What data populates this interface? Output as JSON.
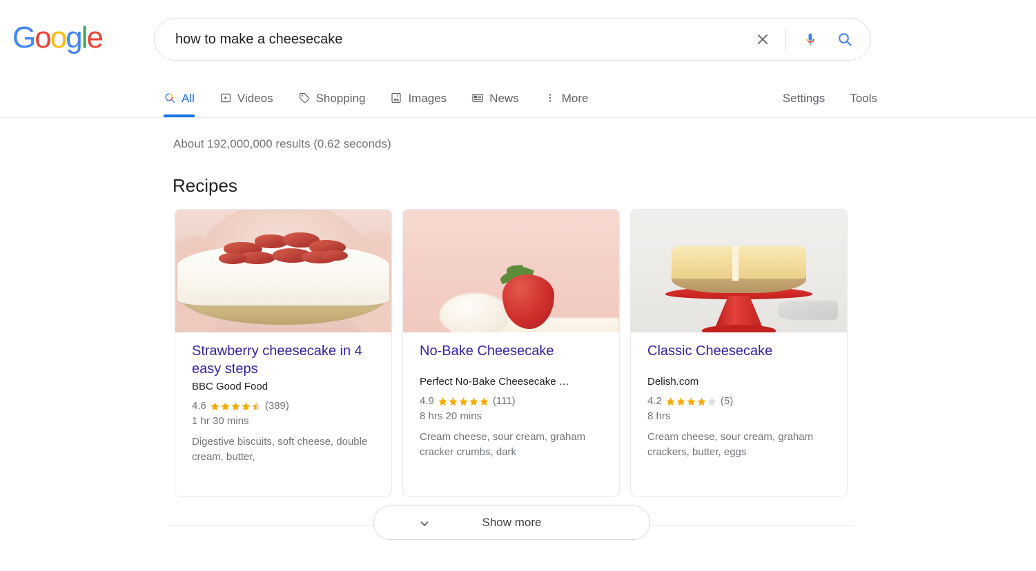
{
  "brand": {
    "name": "Google",
    "letters": [
      {
        "char": "G",
        "color": "#4285f4"
      },
      {
        "char": "o",
        "color": "#ea4335"
      },
      {
        "char": "o",
        "color": "#fbbc05"
      },
      {
        "char": "g",
        "color": "#4285f4"
      },
      {
        "char": "l",
        "color": "#34a853"
      },
      {
        "char": "e",
        "color": "#ea4335"
      }
    ]
  },
  "search": {
    "value": "how to make a cheesecake",
    "placeholder": "Search",
    "clear_icon": "close-icon",
    "mic_icon": "microphone-icon",
    "search_icon": "search-icon"
  },
  "nav": {
    "tabs": [
      {
        "label": "All",
        "icon": "search-icon",
        "active": true
      },
      {
        "label": "Videos",
        "icon": "video-icon",
        "active": false
      },
      {
        "label": "Shopping",
        "icon": "tag-icon",
        "active": false
      },
      {
        "label": "Images",
        "icon": "image-icon",
        "active": false
      },
      {
        "label": "News",
        "icon": "news-icon",
        "active": false
      },
      {
        "label": "More",
        "icon": "more-vertical-icon",
        "active": false
      }
    ],
    "settings_label": "Settings",
    "tools_label": "Tools",
    "active_color": "#1a73e8"
  },
  "results": {
    "stats": "About 192,000,000 results (0.62 seconds)",
    "section_title": "Recipes"
  },
  "recipes": [
    {
      "title": "Strawberry cheesecake in 4 easy steps",
      "source": "BBC Good Food",
      "rating": "4.6",
      "rating_value": 4.6,
      "reviews": "(389)",
      "time": "1 hr 30 mins",
      "ingredients": "Digestive biscuits, soft cheese, double cream, butter,",
      "image_alt": "strawberry-cheesecake-photo"
    },
    {
      "title": "No-Bake Cheesecake",
      "source": "Perfect No-Bake Cheesecake …",
      "rating": "4.9",
      "rating_value": 4.9,
      "reviews": "(111)",
      "time": "8 hrs 20 mins",
      "ingredients": "Cream cheese, sour cream, graham cracker crumbs, dark",
      "image_alt": "no-bake-cheesecake-photo"
    },
    {
      "title": "Classic Cheesecake",
      "source": "Delish.com",
      "rating": "4.2",
      "rating_value": 4.2,
      "reviews": "(5)",
      "time": "8 hrs",
      "ingredients": "Cream cheese, sour cream, graham crackers, butter, eggs",
      "image_alt": "classic-cheesecake-photo"
    }
  ],
  "show_more": {
    "label": "Show more",
    "icon": "chevron-down-icon"
  },
  "colors": {
    "link": "#3423a6",
    "star_filled": "#f8ab00",
    "star_empty": "#dadce0",
    "text_secondary": "#70757a"
  }
}
